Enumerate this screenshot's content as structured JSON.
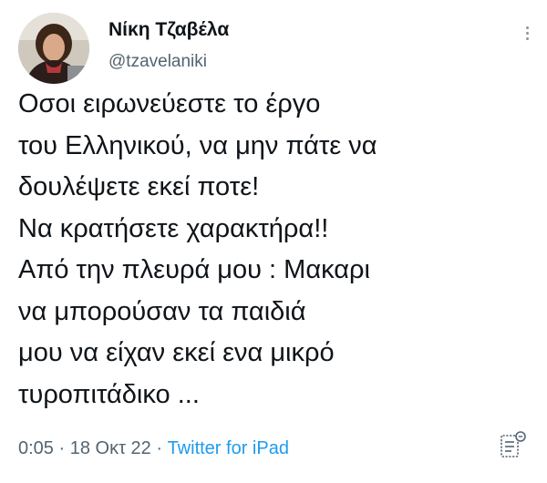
{
  "tweet": {
    "author": {
      "display_name": "Νίκη Τζαβέλα",
      "handle": "@tzavelaniki"
    },
    "text_lines": [
      "Οσοι ειρωνεύεστε το έργο",
      "του Ελληνικού, να μην πάτε να",
      "δουλέψετε εκεί ποτε!",
      "Να κρατήσετε χαρακτήρα!!",
      "Από την πλευρά μου : Μακαρι",
      "να μπορούσαν τα παιδιά",
      "μου να είχαν εκεί ενα μικρό",
      "τυροπιτάδικο ..."
    ],
    "meta": {
      "time": "0:05",
      "separator_1": " · ",
      "date": "18 Οκτ 22",
      "separator_2": " · ",
      "source": "Twitter for iPad"
    },
    "icons": {
      "more": "more-vertical-icon",
      "analytics": "analytics-icon",
      "avatar": "profile-photo"
    },
    "colors": {
      "text": "#0f1419",
      "secondary": "#536471",
      "link": "#1d9bf0",
      "background": "#ffffff"
    }
  }
}
